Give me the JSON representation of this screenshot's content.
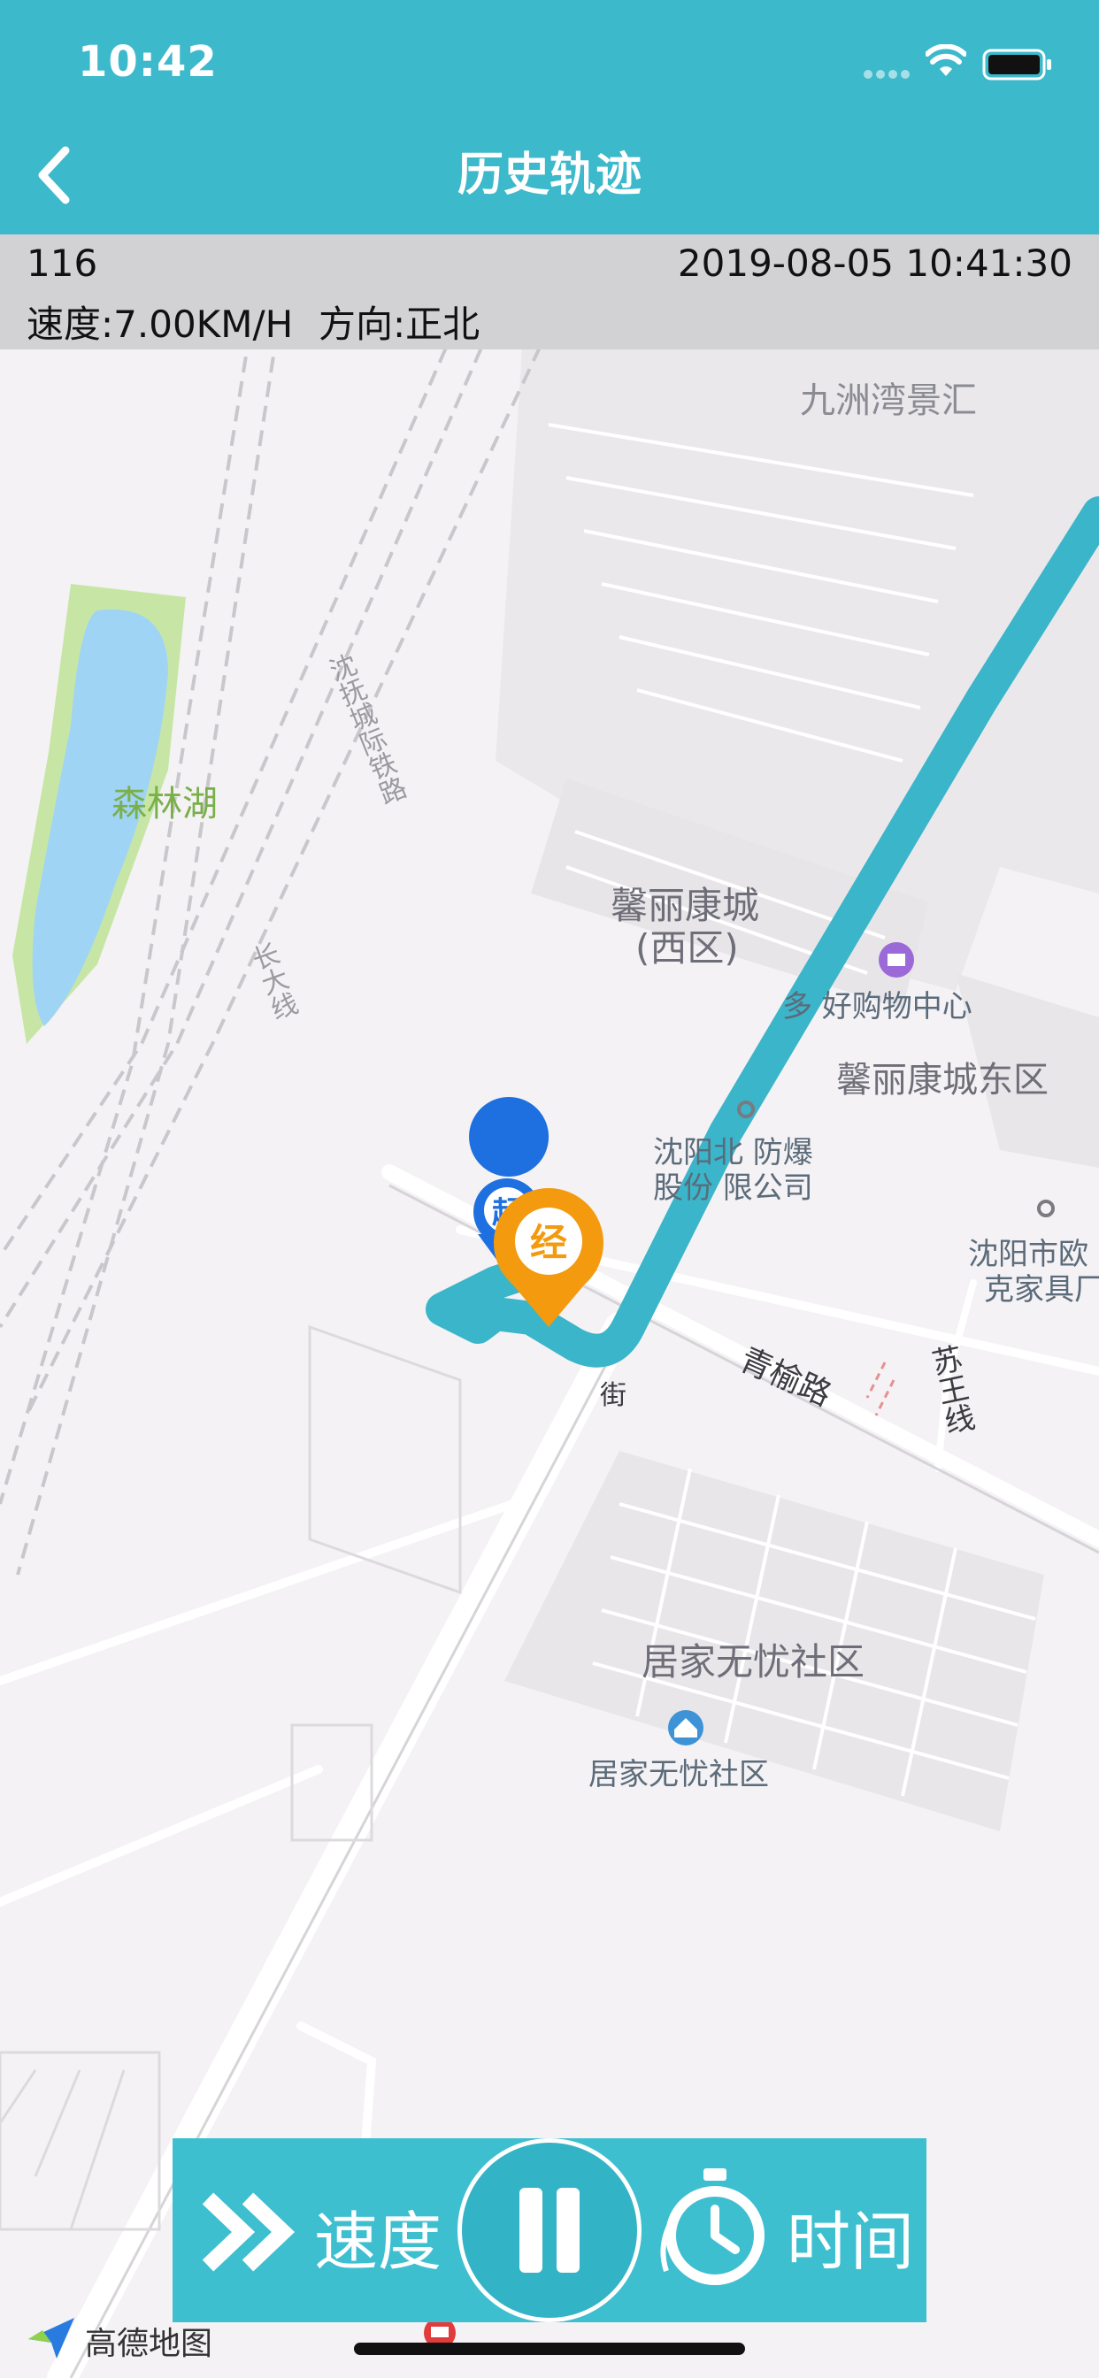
{
  "status_bar": {
    "time": "10:42"
  },
  "nav": {
    "title": "历史轨迹"
  },
  "info": {
    "id": "116",
    "datetime": "2019-08-05 10:41:30",
    "speed": "速度:7.00KM/H",
    "direction": "方向:正北"
  },
  "map": {
    "labels": {
      "jiuzhou": "九洲湾景汇",
      "senlin": "森林湖",
      "xinli_west_1": "馨丽康城",
      "xinli_west_2": "(西区)",
      "duo_shopping": "多  好购物中心",
      "xinli_east": "馨丽康城东区",
      "fangbao_1": "沈阳北  防爆",
      "fangbao_2": "股份  限公司",
      "oushi_1": "沈阳市欧",
      "oushi_2": "克家具厂",
      "qingyu": "青榆路",
      "suwang": "苏王线",
      "shenfu_rail": "沈抚城际铁路",
      "changda": "长大线",
      "jujia_area": "居家无忧社区",
      "jujia_poi": "居家无忧社区",
      "jie": "街",
      "amap": "高德地图"
    },
    "start_marker_text": "起",
    "via_marker_text": "经",
    "colors": {
      "track": "#3bb5c9",
      "via": "#f39a0f",
      "start": "#1e6fe0"
    }
  },
  "controls": {
    "speed_label": "速度",
    "time_label": "时间",
    "state": "paused"
  }
}
